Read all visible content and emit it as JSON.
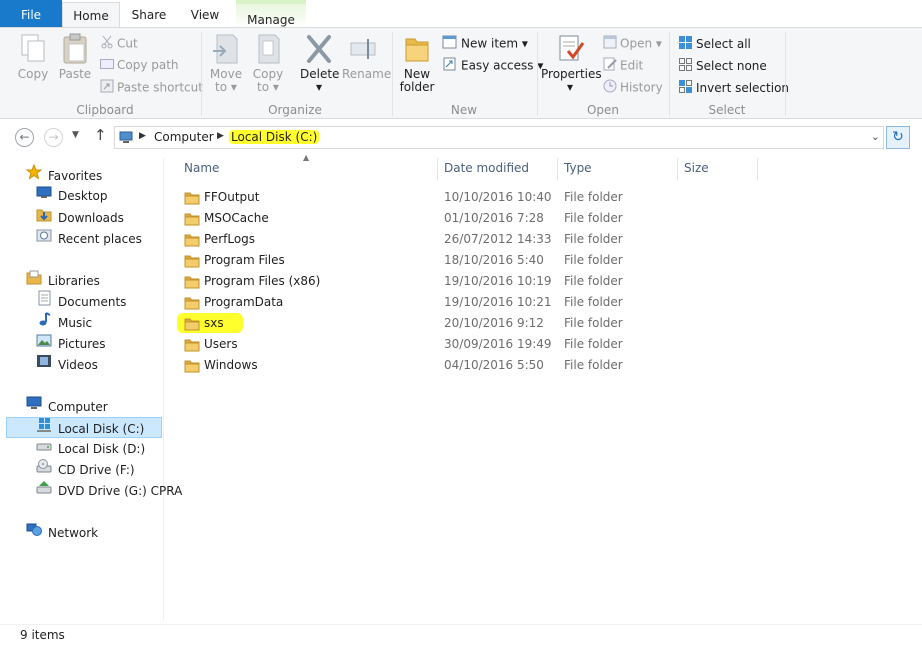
{
  "tabs": {
    "file": "File",
    "home": "Home",
    "share": "Share",
    "view": "View",
    "manage": "Manage"
  },
  "ribbon": {
    "clipboard": {
      "label": "Clipboard",
      "copy": "Copy",
      "paste": "Paste",
      "cut": "Cut",
      "copy_path": "Copy path",
      "paste_shortcut": "Paste shortcut"
    },
    "organize": {
      "label": "Organize",
      "move_to_1": "Move",
      "move_to_2": "to",
      "copy_to_1": "Copy",
      "copy_to_2": "to",
      "delete": "Delete",
      "rename": "Rename"
    },
    "new": {
      "label": "New",
      "new_folder_1": "New",
      "new_folder_2": "folder",
      "new_item": "New item",
      "easy_access": "Easy access"
    },
    "open": {
      "label": "Open",
      "properties": "Properties",
      "open": "Open",
      "edit": "Edit",
      "history": "History"
    },
    "select": {
      "label": "Select",
      "select_all": "Select all",
      "select_none": "Select none",
      "invert_selection": "Invert selection"
    }
  },
  "address": {
    "crumb_computer": "Computer",
    "crumb_drive": "Local Disk (C:)"
  },
  "navpane": {
    "favorites": "Favorites",
    "desktop": "Desktop",
    "downloads": "Downloads",
    "recent_places": "Recent places",
    "libraries": "Libraries",
    "documents": "Documents",
    "music": "Music",
    "pictures": "Pictures",
    "videos": "Videos",
    "computer": "Computer",
    "local_c": "Local Disk (C:)",
    "local_d": "Local Disk (D:)",
    "cd_f": "CD Drive (F:)",
    "dvd_g": "DVD Drive (G:) CPRA",
    "network": "Network"
  },
  "columns": {
    "name": "Name",
    "date_modified": "Date modified",
    "type": "Type",
    "size": "Size"
  },
  "files": [
    {
      "name": "FFOutput",
      "date": "10/10/2016 10:40",
      "type": "File folder"
    },
    {
      "name": "MSOCache",
      "date": "01/10/2016 7:28",
      "type": "File folder"
    },
    {
      "name": "PerfLogs",
      "date": "26/07/2012 14:33",
      "type": "File folder"
    },
    {
      "name": "Program Files",
      "date": "18/10/2016 5:40",
      "type": "File folder"
    },
    {
      "name": "Program Files (x86)",
      "date": "19/10/2016 10:19",
      "type": "File folder"
    },
    {
      "name": "ProgramData",
      "date": "19/10/2016 10:21",
      "type": "File folder"
    },
    {
      "name": "sxs",
      "date": "20/10/2016 9:12",
      "type": "File folder"
    },
    {
      "name": "Users",
      "date": "30/09/2016 19:49",
      "type": "File folder"
    },
    {
      "name": "Windows",
      "date": "04/10/2016 5:50",
      "type": "File folder"
    }
  ],
  "status": {
    "count": "9 items"
  },
  "colors": {
    "file_tab": "#1979ca",
    "highlight": "#ffff2e",
    "selection": "#cce8ff",
    "folder": "#e8b64a"
  }
}
